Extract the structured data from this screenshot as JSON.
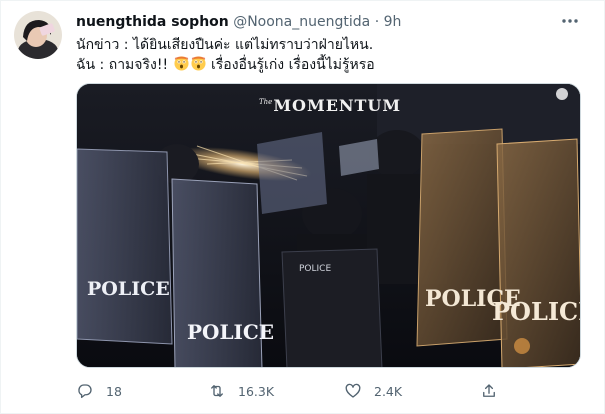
{
  "tweet": {
    "display_name": "nuengthida sophon",
    "handle": "@Noona_nuengtida",
    "separator": "·",
    "time": "9h",
    "line1": "นักข่าว : ได้ยินเสียงปืนค่ะ แต่ไม่ทราบว่าฝ่ายไหน.",
    "line2_prefix": "ฉัน : ถามจริง!!",
    "line2_suffix": "เรื่องอื่นรู้เก่ง เรื่องนี้ไม่รู้หรอ",
    "emoji": "astonished-face"
  },
  "media": {
    "watermark_prefix": "The",
    "watermark_main": "MOMENTUM",
    "shield_labels": [
      "POLICE",
      "POLICE",
      "POLICE",
      "POLICE",
      "POLICE"
    ]
  },
  "actions": {
    "reply_count": "18",
    "retweet_count": "16.3K",
    "like_count": "2.4K"
  },
  "colors": {
    "text": "#0f1419",
    "secondary": "#536471",
    "border": "#cfd9de"
  }
}
